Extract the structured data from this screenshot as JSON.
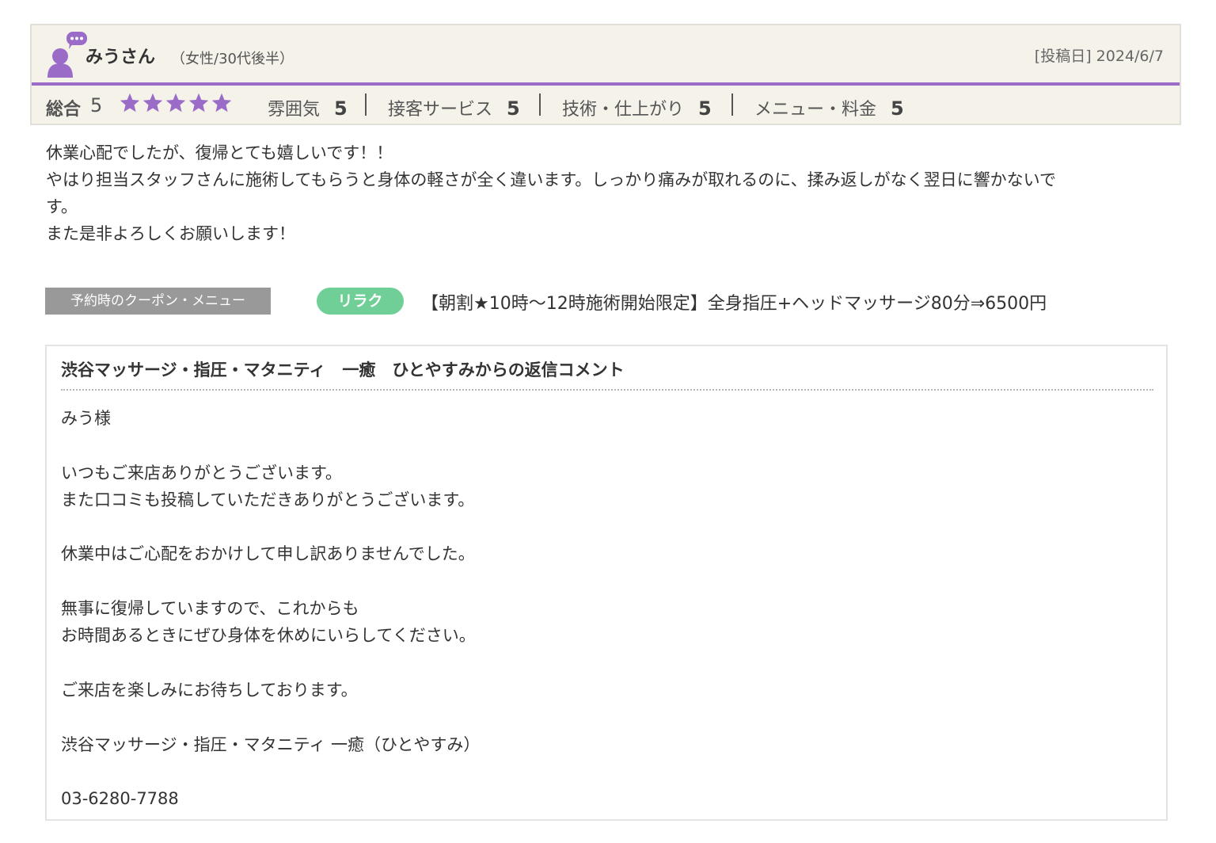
{
  "reviewer": {
    "name": "みうさん",
    "meta": "（女性/30代後半）",
    "post_date": "[投稿日] 2024/6/7"
  },
  "ratings": {
    "overall_label": "総合",
    "overall_score": "5",
    "stars_filled": 5,
    "items": [
      {
        "label": "雰囲気",
        "value": "5"
      },
      {
        "label": "接客サービス",
        "value": "5"
      },
      {
        "label": "技術・仕上がり",
        "value": "5"
      },
      {
        "label": "メニュー・料金",
        "value": "5"
      }
    ]
  },
  "review_body": [
    "休業心配でしたが、復帰とても嬉しいです！！",
    "やはり担当スタッフさんに施術してもらうと身体の軽さが全く違います。しっかり痛みが取れるのに、揉み返しがなく翌日に響かないで",
    "す。",
    "また是非よろしくお願いします！"
  ],
  "coupon": {
    "label": "予約時のクーポン・メニュー",
    "badge": "リラク",
    "text": "【朝割★10時〜12時施術開始限定】全身指圧+ヘッドマッサージ80分⇒6500円"
  },
  "reply": {
    "title": "渋谷マッサージ・指圧・マタニティ　一癒　ひとやすみからの返信コメント",
    "lines": [
      "みう様",
      "",
      "いつもご来店ありがとうございます。",
      "また口コミも投稿していただきありがとうございます。",
      "",
      "休業中はご心配をおかけして申し訳ありませんでした。",
      "",
      "無事に復帰していますので、これからも",
      "お時間あるときにぜひ身体を休めにいらしてください。",
      "",
      "ご来店を楽しみにお待ちしております。",
      "",
      "渋谷マッサージ・指圧・マタニティ 一癒（ひとやすみ）",
      "",
      "03-6280-7788"
    ]
  },
  "colors": {
    "accent_purple": "#9b6bc8",
    "header_bg": "#f5f2ea",
    "badge_green": "#6fcf97",
    "coupon_gray": "#999999"
  },
  "icons": {
    "avatar": "user-comment-icon",
    "star": "star-icon"
  }
}
